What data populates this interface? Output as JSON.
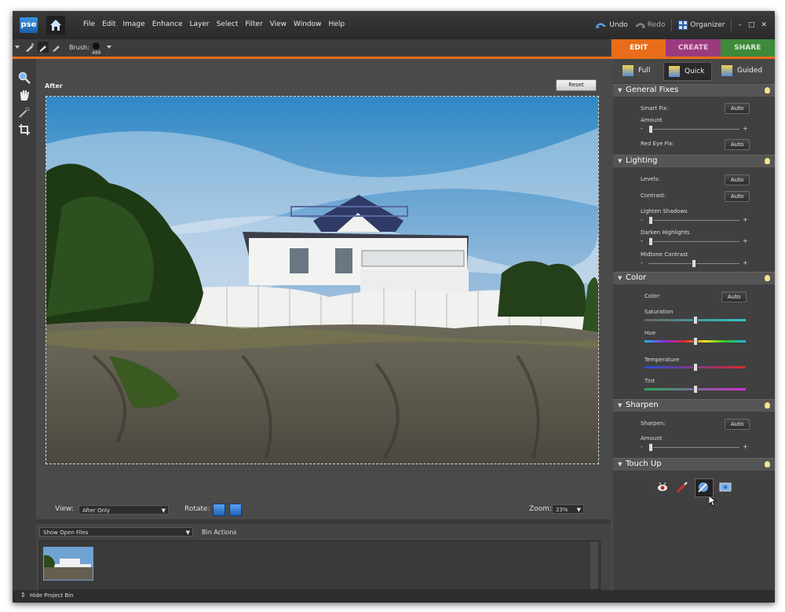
{
  "app": {
    "logo": "pse"
  },
  "menu": [
    "File",
    "Edit",
    "Image",
    "Enhance",
    "Layer",
    "Select",
    "Filter",
    "View",
    "Window",
    "Help"
  ],
  "topright": {
    "undo": "Undo",
    "redo": "Redo",
    "organizer": "Organizer",
    "min": "–",
    "max": "□",
    "close": "✕"
  },
  "toolopts": {
    "brush_label": "Brush:",
    "brush_size": "489"
  },
  "tabs": {
    "edit": "EDIT",
    "create": "CREATE",
    "share": "SHARE"
  },
  "canvas": {
    "after_label": "After",
    "reset": "Reset"
  },
  "viewbar": {
    "view_label": "View:",
    "view_value": "After Only",
    "rotate_label": "Rotate:",
    "zoom_label": "Zoom:",
    "zoom_value": "23%"
  },
  "bin": {
    "show_value": "Show Open Files",
    "bin_actions": "Bin Actions",
    "hide_project_bin": "Hide Project Bin"
  },
  "panel": {
    "modes": {
      "full": "Full",
      "quick": "Quick",
      "guided": "Guided"
    },
    "general_fixes": {
      "title": "General Fixes",
      "smart_fix": "Smart Fix:",
      "amount": "Amount",
      "red_eye": "Red Eye Fix:",
      "auto": "Auto"
    },
    "lighting": {
      "title": "Lighting",
      "levels": "Levels:",
      "contrast": "Contrast:",
      "lighten_shadows": "Lighten Shadows",
      "darken_highlights": "Darken Highlights",
      "midtone_contrast": "Midtone Contrast"
    },
    "color": {
      "title": "Color",
      "color": "Color:",
      "saturation": "Saturation",
      "hue": "Hue",
      "temperature": "Temperature",
      "tint": "Tint"
    },
    "sharpen": {
      "title": "Sharpen",
      "sharpen": "Sharpen:",
      "amount": "Amount"
    },
    "touch_up": {
      "title": "Touch Up"
    },
    "minus": "-",
    "plus": "+"
  },
  "sliders": {
    "smart_fix_amount": 0.0,
    "lighten_shadows": 0.0,
    "darken_highlights": 0.0,
    "midtone_contrast": 0.5,
    "saturation": 0.5,
    "hue": 0.5,
    "temperature": 0.5,
    "tint": 0.5,
    "sharpen_amount": 0.0
  },
  "colors": {
    "accent": "#e86d1a",
    "create": "#9b3b7e",
    "share": "#3d8a3b"
  }
}
